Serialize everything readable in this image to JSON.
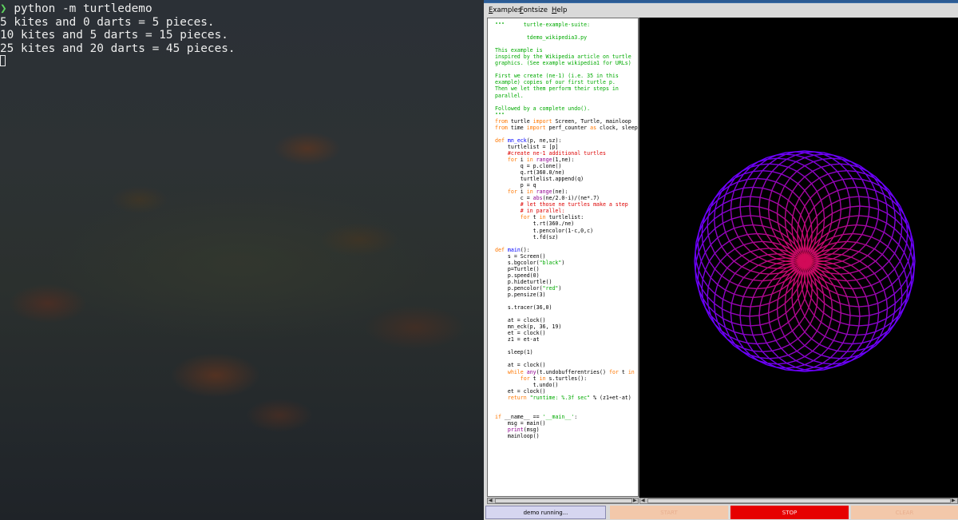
{
  "terminal": {
    "prompt_symbol": "❯",
    "command": "python -m turtledemo",
    "output": [
      "5 kites and 0 darts = 5 pieces.",
      "10 kites and 5 darts = 15 pieces.",
      "25 kites and 20 darts = 45 pieces."
    ]
  },
  "menu": {
    "examples_first": "E",
    "examples_rest": "xamples",
    "fontsize_first": "F",
    "fontsize_rest": "ontsize",
    "help_first": "H",
    "help_rest": "elp"
  },
  "status": {
    "label": "demo running...",
    "start": "START",
    "stop": "STOP",
    "clear": "CLEAR"
  },
  "drawing": {
    "turtles": 36,
    "shape_steps": 19,
    "outer_color": "#ff1010",
    "inner_color": "#6a00ff",
    "background": "#000000"
  },
  "colors": {
    "accent": "#2c5b93",
    "stop": "#e60000",
    "idle_button": "#f3c8aa",
    "status_bg": "#d6d6f0"
  }
}
